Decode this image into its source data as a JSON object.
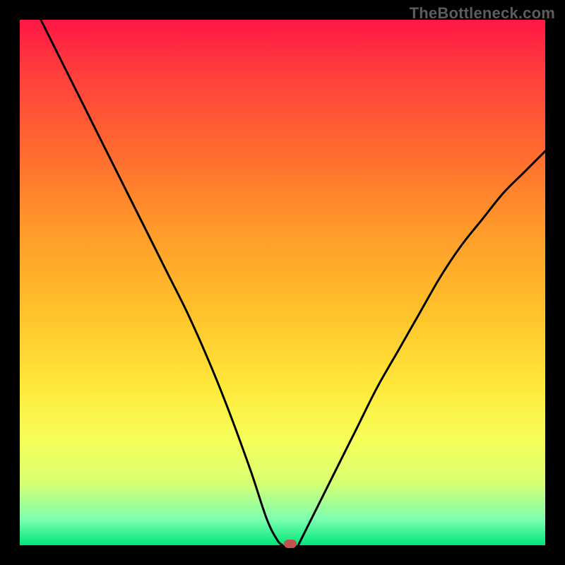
{
  "watermark": "TheBottleneck.com",
  "chart_data": {
    "type": "line",
    "title": "",
    "xlabel": "",
    "ylabel": "",
    "xlim": [
      0,
      100
    ],
    "ylim": [
      0,
      100
    ],
    "grid": false,
    "legend": false,
    "series": [
      {
        "name": "left-branch",
        "x": [
          4,
          8,
          12,
          16,
          20,
          24,
          28,
          32,
          36,
          40,
          44,
          47,
          49,
          50
        ],
        "values": [
          100,
          92,
          84,
          76,
          68,
          60,
          52,
          44,
          35,
          25,
          14,
          5,
          1,
          0
        ]
      },
      {
        "name": "right-branch",
        "x": [
          53,
          56,
          60,
          64,
          68,
          72,
          76,
          80,
          84,
          88,
          92,
          96,
          100
        ],
        "values": [
          0,
          6,
          14,
          22,
          30,
          37,
          44,
          51,
          57,
          62,
          67,
          71,
          75
        ]
      }
    ],
    "marker": {
      "x": 51.5,
      "y": 0
    },
    "gradient_stops": [
      {
        "pos": 0,
        "color": "#ff1744"
      },
      {
        "pos": 10,
        "color": "#ff3d3d"
      },
      {
        "pos": 25,
        "color": "#ff6a2f"
      },
      {
        "pos": 40,
        "color": "#ff9a2a"
      },
      {
        "pos": 55,
        "color": "#ffc02a"
      },
      {
        "pos": 70,
        "color": "#ffe93a"
      },
      {
        "pos": 80,
        "color": "#f6ff5a"
      },
      {
        "pos": 88,
        "color": "#d8ff70"
      },
      {
        "pos": 95,
        "color": "#7dffb0"
      },
      {
        "pos": 100,
        "color": "#00e57a"
      }
    ]
  }
}
